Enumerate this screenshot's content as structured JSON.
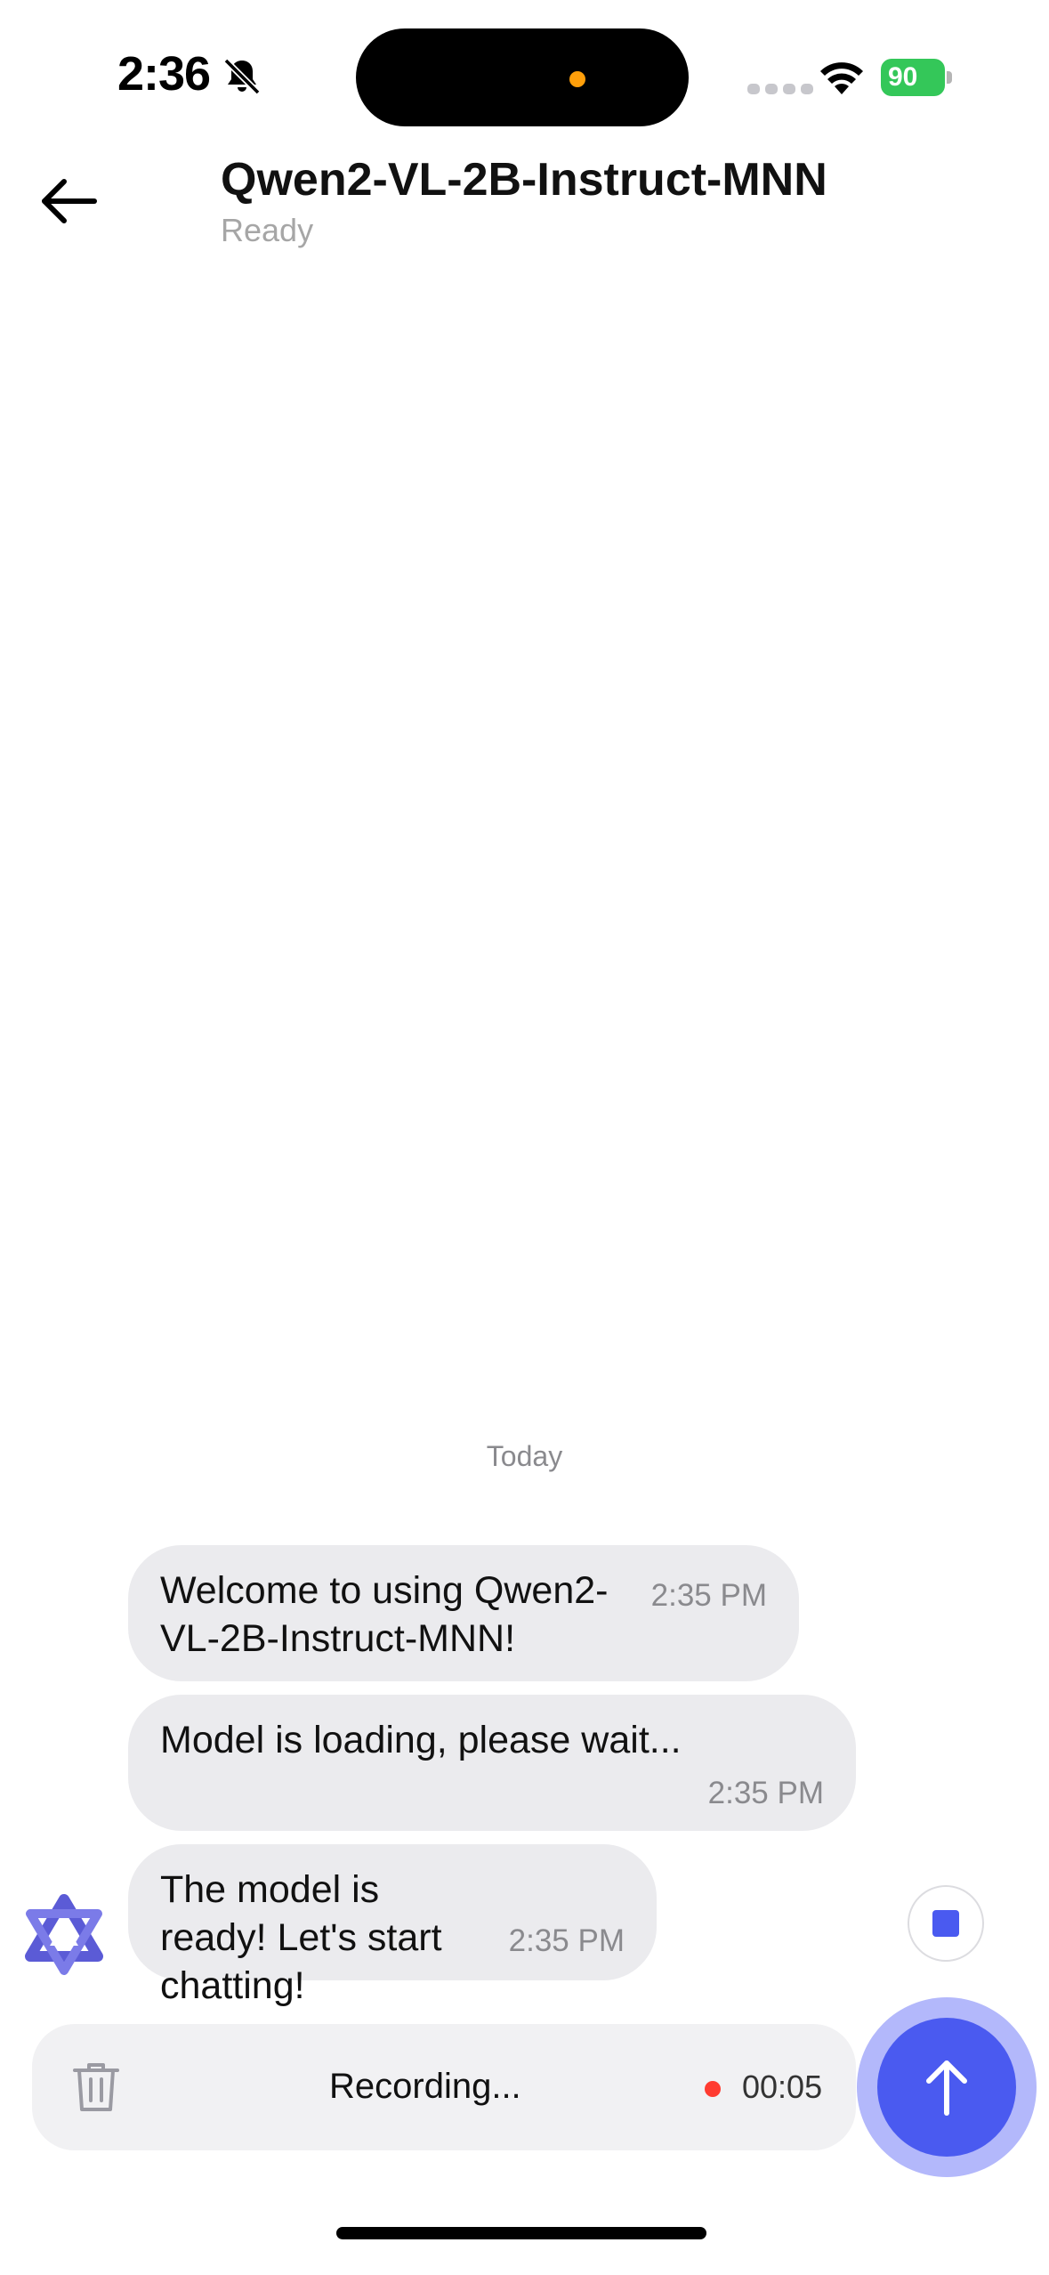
{
  "status_bar": {
    "time": "2:36",
    "battery_level": "90",
    "icons": [
      "bell-slash-icon",
      "cellular-signal-icon",
      "wifi-icon",
      "battery-charging-icon"
    ]
  },
  "header": {
    "title": "Qwen2-VL-2B-Instruct-MNN",
    "status": "Ready",
    "back_icon": "arrow-left-icon"
  },
  "chat": {
    "date_separator": "Today",
    "messages": [
      {
        "text": "Welcome to using Qwen2-VL-2B-Instruct-MNN!",
        "time": "2:35 PM"
      },
      {
        "text": "Model is loading, please wait...",
        "time": "2:35 PM"
      },
      {
        "text": "The model is ready! Let's start chatting!",
        "time": "2:35 PM"
      }
    ],
    "avatar_icon": "qwen-logo-icon"
  },
  "input_bar": {
    "recording_label": "Recording...",
    "timer": "00:05",
    "delete_icon": "trash-icon",
    "send_icon": "arrow-up-icon",
    "stop_icon": "stop-icon"
  },
  "colors": {
    "accent": "#4a5af0",
    "accent_halo": "#b3b8fb",
    "bubble": "#ebebee",
    "record_dot": "#ff3b30",
    "battery": "#34c759"
  }
}
